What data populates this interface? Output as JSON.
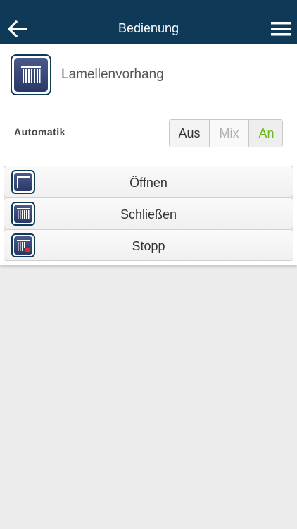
{
  "header": {
    "title": "Bedienung",
    "background": "#0e3a57"
  },
  "device": {
    "name": "Lamellenvorhang",
    "icon": "vertical-blinds-icon"
  },
  "automatik": {
    "label": "Automatik",
    "options": [
      "Aus",
      "Mix",
      "An"
    ],
    "selected": "An",
    "selected_color": "#6bb51a"
  },
  "actions": [
    {
      "label": "Öffnen",
      "icon": "blinds-open-icon"
    },
    {
      "label": "Schließen",
      "icon": "blinds-closed-icon"
    },
    {
      "label": "Stopp",
      "icon": "blinds-stop-icon"
    }
  ]
}
